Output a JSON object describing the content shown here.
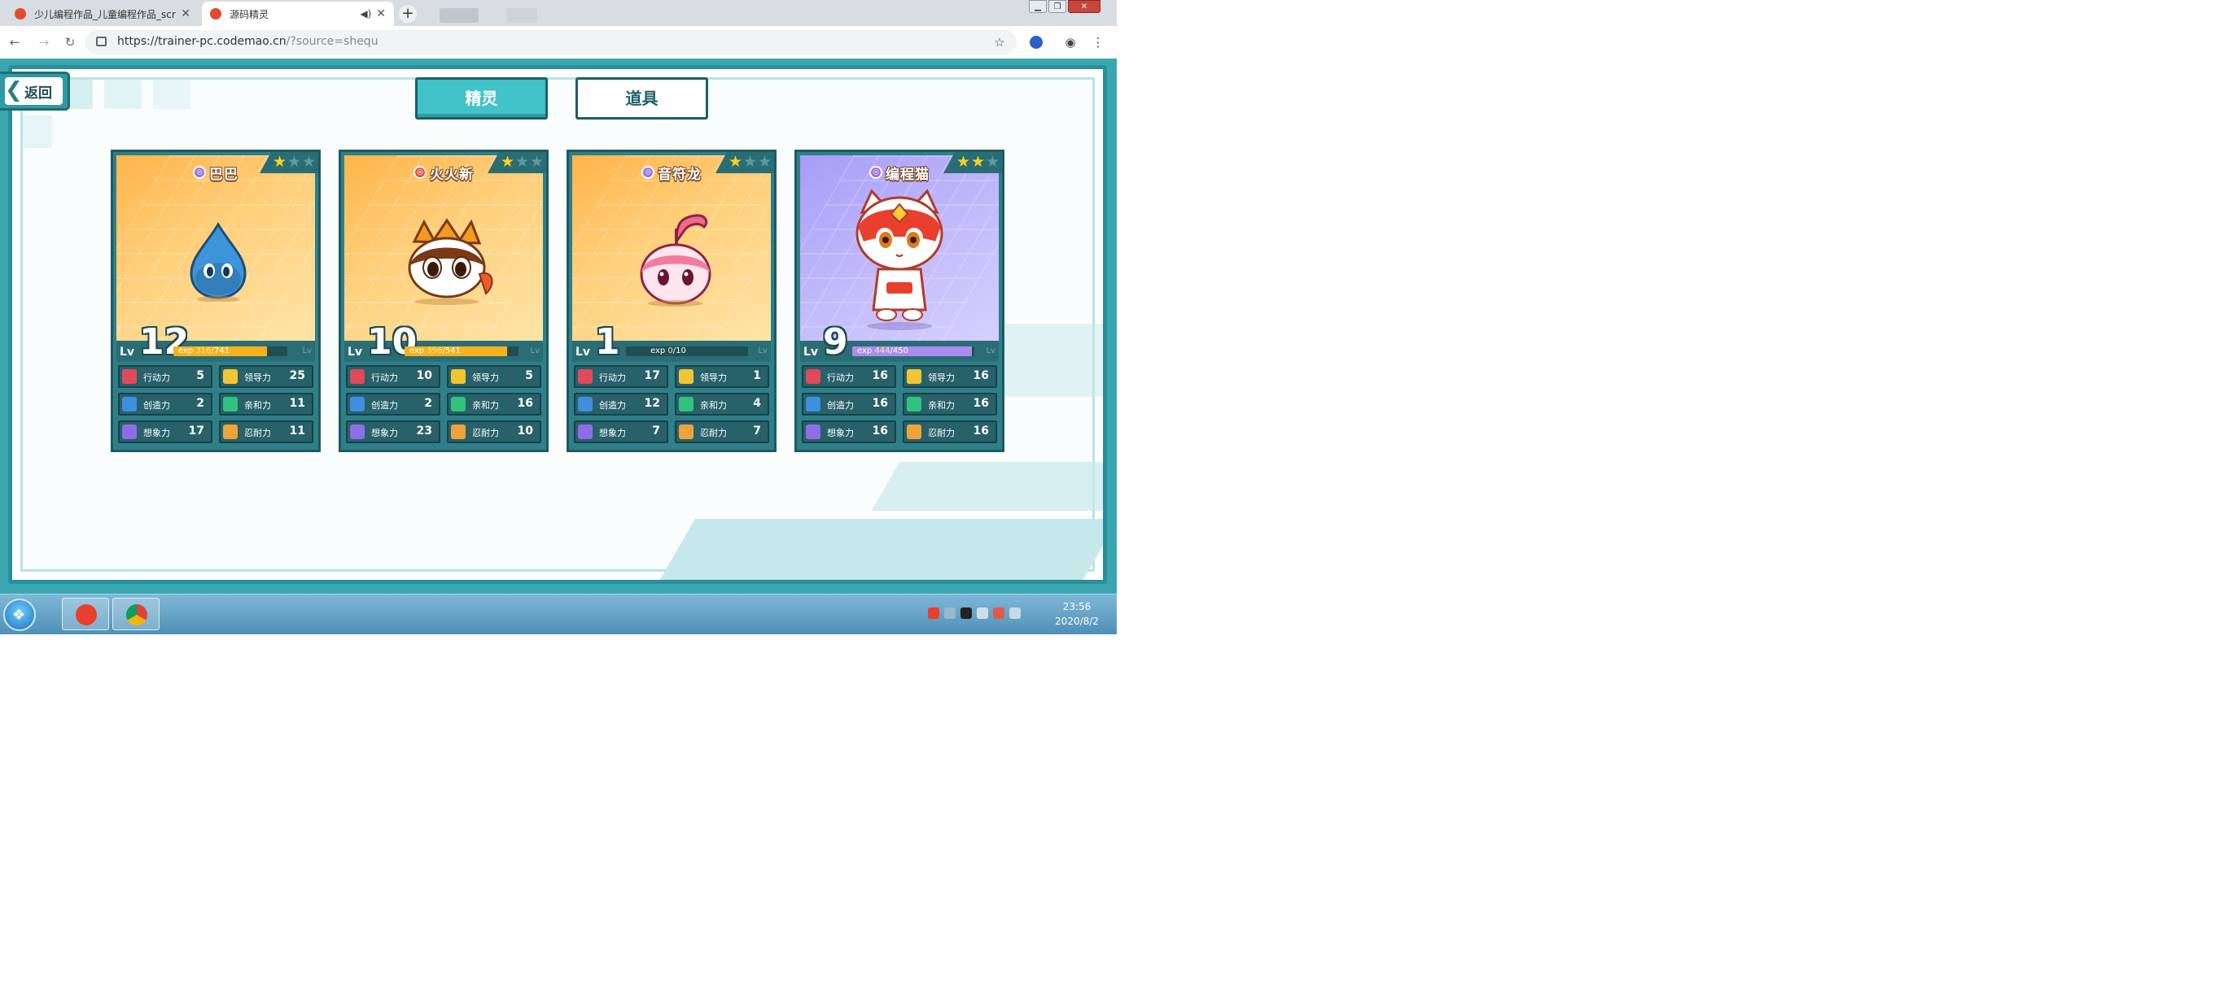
{
  "browser": {
    "tabs": [
      {
        "title": "少儿编程作品_儿童编程作品_scr",
        "active": false
      },
      {
        "title": "源码精灵",
        "active": true
      }
    ],
    "url_host": "https://trainer-pc.codemao.cn",
    "url_path": "/?source=shequ"
  },
  "page": {
    "back_label": "返回",
    "tabs": [
      {
        "label": "精灵",
        "selected": true
      },
      {
        "label": "道具",
        "selected": false
      }
    ]
  },
  "cards": [
    {
      "name": "巴巴",
      "stars": 1,
      "max_stars": 3,
      "theme": "orange",
      "level": "12",
      "exp_current": "316",
      "exp_total": "741",
      "exp_fraction": 0.82,
      "exp_color": "#f5b21d",
      "stats": [
        {
          "label": "行动力",
          "value": "5"
        },
        {
          "label": "领导力",
          "value": "25"
        },
        {
          "label": "创造力",
          "value": "2"
        },
        {
          "label": "亲和力",
          "value": "11"
        },
        {
          "label": "想象力",
          "value": "17"
        },
        {
          "label": "忍耐力",
          "value": "11"
        }
      ]
    },
    {
      "name": "火火新",
      "stars": 1,
      "max_stars": 3,
      "theme": "orange",
      "level": "10",
      "exp_current": "396",
      "exp_total": "541",
      "exp_fraction": 0.9,
      "exp_color": "#f5b21d",
      "stats": [
        {
          "label": "行动力",
          "value": "10"
        },
        {
          "label": "领导力",
          "value": "5"
        },
        {
          "label": "创造力",
          "value": "2"
        },
        {
          "label": "亲和力",
          "value": "16"
        },
        {
          "label": "想象力",
          "value": "23"
        },
        {
          "label": "忍耐力",
          "value": "10"
        }
      ]
    },
    {
      "name": "音符龙",
      "stars": 1,
      "max_stars": 3,
      "theme": "orange",
      "level": "1",
      "exp_current": "0",
      "exp_total": "10",
      "exp_fraction": 0.0,
      "exp_color": "#f5b21d",
      "stats": [
        {
          "label": "行动力",
          "value": "17"
        },
        {
          "label": "领导力",
          "value": "1"
        },
        {
          "label": "创造力",
          "value": "12"
        },
        {
          "label": "亲和力",
          "value": "4"
        },
        {
          "label": "想象力",
          "value": "7"
        },
        {
          "label": "忍耐力",
          "value": "7"
        }
      ]
    },
    {
      "name": "编程猫",
      "stars": 2,
      "max_stars": 3,
      "theme": "purple",
      "level": "9",
      "exp_current": "444",
      "exp_total": "450",
      "exp_fraction": 0.98,
      "exp_color": "#a98cf0",
      "stats": [
        {
          "label": "行动力",
          "value": "16"
        },
        {
          "label": "领导力",
          "value": "16"
        },
        {
          "label": "创造力",
          "value": "16"
        },
        {
          "label": "亲和力",
          "value": "16"
        },
        {
          "label": "想象力",
          "value": "16"
        },
        {
          "label": "忍耐力",
          "value": "16"
        }
      ]
    }
  ],
  "stat_icon_colors": [
    "#e04a5a",
    "#f2c533",
    "#3f8fe0",
    "#30c27f",
    "#8f6de6",
    "#f0a23a"
  ],
  "taskbar": {
    "time": "23:56",
    "date": "2020/8/2"
  }
}
